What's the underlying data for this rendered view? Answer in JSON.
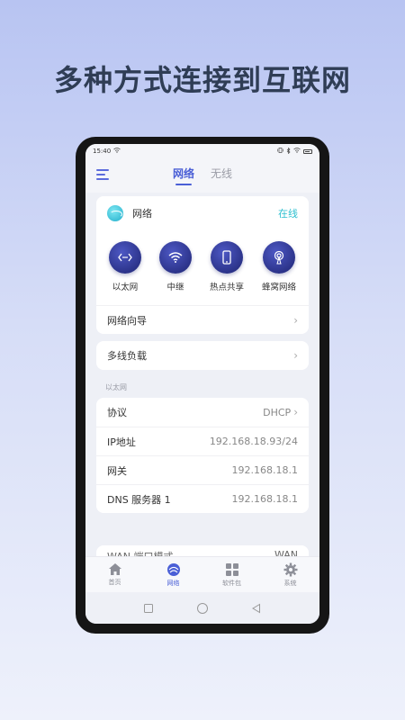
{
  "headline": "多种方式连接到互联网",
  "statusbar": {
    "time": "15:40"
  },
  "header": {
    "tabs": [
      {
        "label": "网络",
        "active": true
      },
      {
        "label": "无线",
        "active": false
      }
    ]
  },
  "network_card": {
    "title": "网络",
    "status": "在线",
    "modes": [
      {
        "label": "以太网",
        "icon": "ethernet-icon"
      },
      {
        "label": "中继",
        "icon": "wifi-icon"
      },
      {
        "label": "热点共享",
        "icon": "phone-hotspot-icon"
      },
      {
        "label": "蜂窝网络",
        "icon": "cellular-icon"
      }
    ],
    "wizard_label": "网络向导"
  },
  "multiline": {
    "label": "多线负载"
  },
  "ethernet_section": {
    "label": "以太网",
    "rows": [
      {
        "label": "协议",
        "value": "DHCP",
        "has_chevron": true
      },
      {
        "label": "IP地址",
        "value": "192.168.18.93/24",
        "has_chevron": false
      },
      {
        "label": "网关",
        "value": "192.168.18.1",
        "has_chevron": false
      },
      {
        "label": "DNS 服务器 1",
        "value": "192.168.18.1",
        "has_chevron": false
      }
    ],
    "partial_row": {
      "label": "WAN 端口模式",
      "value": "WAN"
    }
  },
  "bottom_nav": [
    {
      "label": "首页",
      "icon": "home-icon",
      "active": false
    },
    {
      "label": "网络",
      "icon": "globe-icon",
      "active": true
    },
    {
      "label": "软件包",
      "icon": "grid-icon",
      "active": false
    },
    {
      "label": "系统",
      "icon": "gear-icon",
      "active": false
    }
  ],
  "colors": {
    "accent": "#4a5fd6",
    "online": "#2fc0d0",
    "icon_bg": "#2a3190"
  }
}
